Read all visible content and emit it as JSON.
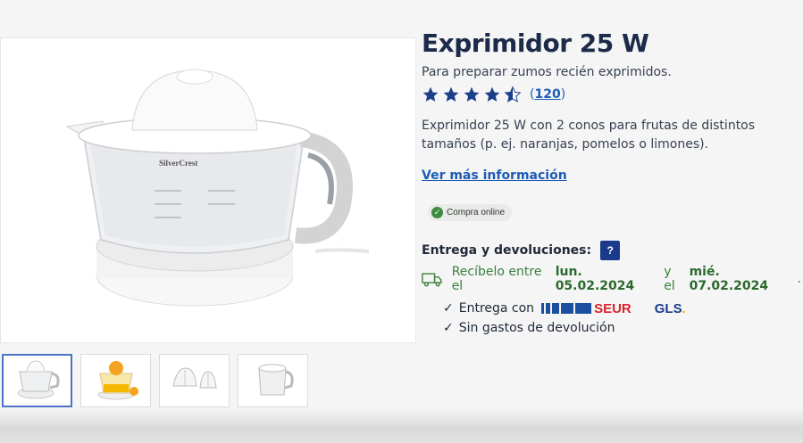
{
  "product": {
    "title": "Exprimidor 25 W",
    "subtitle": "Para preparar zumos recién exprimidos.",
    "rating_value": 4.5,
    "rating_max": 5,
    "review_count": "120",
    "description": "Exprimidor 25 W con 2 conos para frutas de distintos tamaños (p. ej. naranjas, pomelos o limones).",
    "more_info_link": "Ver más información",
    "badge": "Compra online",
    "brand_on_image": "SilverCrest"
  },
  "delivery": {
    "title": "Entrega y devoluciones:",
    "help_label": "?",
    "prefix": "Recíbelo entre el",
    "date_from": "lun. 05.02.2024",
    "connector": "y el",
    "date_to": "mié. 07.02.2024",
    "suffix": ".",
    "bullets": {
      "shipping": "Entrega con",
      "returns": "Sin gastos de devolución"
    },
    "carriers": {
      "seur": "SEUR",
      "gls": "GLS"
    },
    "check_mark": "✓"
  },
  "gallery": {
    "thumbnail_count": 4,
    "active_index": 0
  },
  "colors": {
    "title": "#1c2b4a",
    "link": "#1c5bb5",
    "star": "#1c3f8a",
    "delivery_green": "#3a7f3c",
    "help_button": "#1b3a8c",
    "seur_red": "#d9232d",
    "gls_blue": "#1b3d8f"
  },
  "icons": {
    "star": "star-icon",
    "truck": "truck-icon",
    "badge_check": "check-circle-icon"
  }
}
